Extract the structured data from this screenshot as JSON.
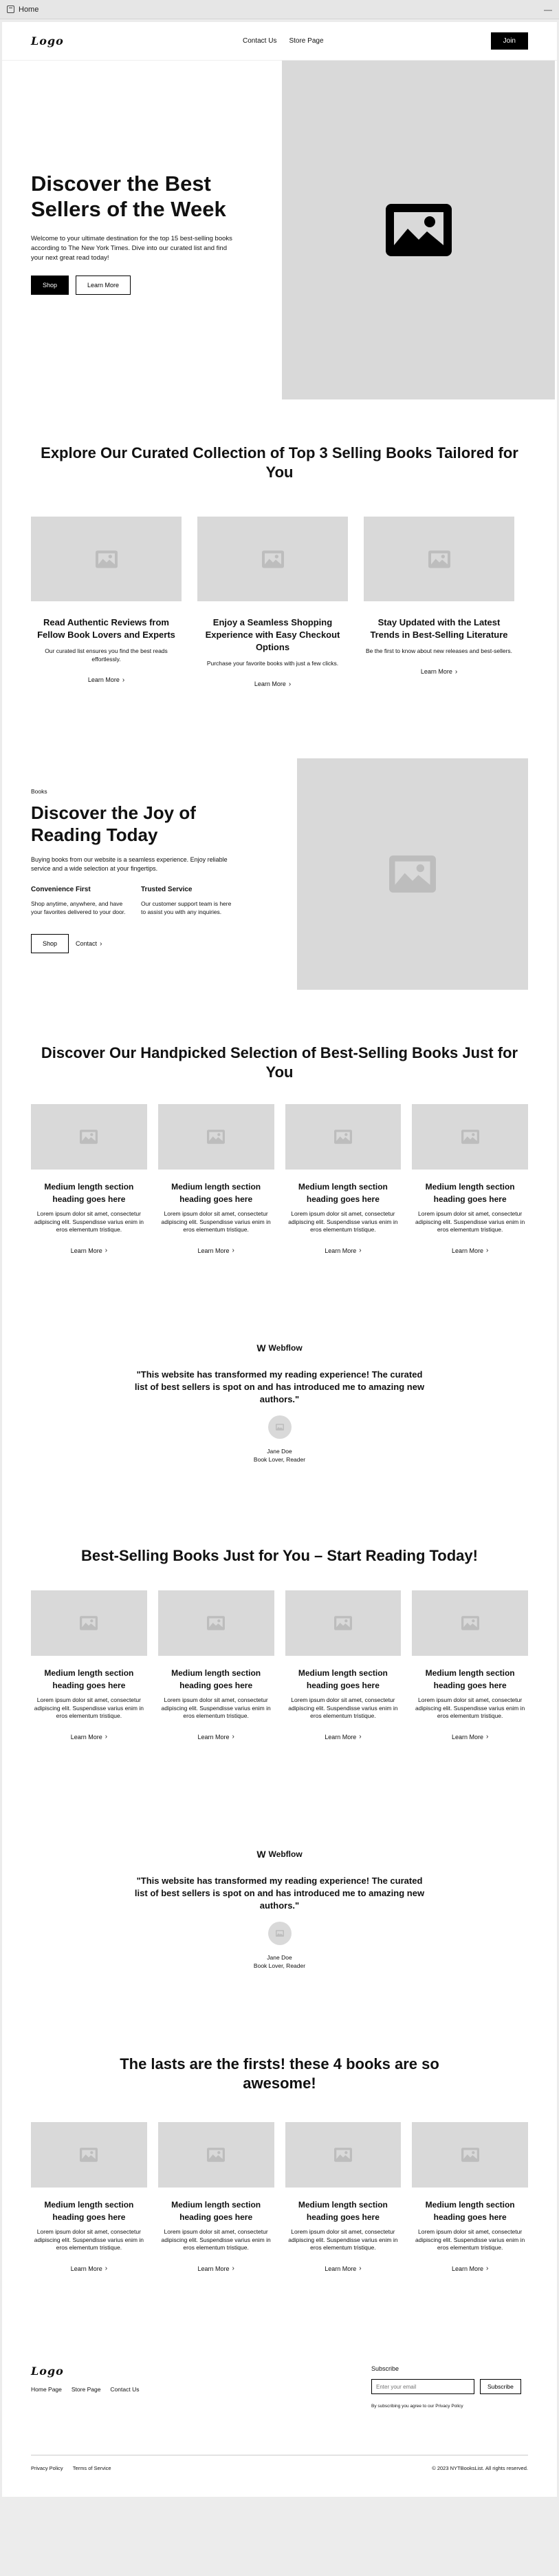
{
  "window": {
    "tab_title": "Home"
  },
  "nav": {
    "logo": "Logo",
    "links": [
      "Contact Us",
      "Store Page"
    ],
    "cta": "Join"
  },
  "hero": {
    "title": "Discover the Best Sellers of the Week",
    "description": "Welcome to your ultimate destination for the top 15 best-selling books according to The New York Times. Dive into our curated list and find your next great read today!",
    "primary": "Shop",
    "secondary": "Learn More"
  },
  "features": {
    "title": "Explore Our Curated Collection of Top 3 Selling Books Tailored for You",
    "items": [
      {
        "title": "Read Authentic Reviews from Fellow Book Lovers and Experts",
        "text": "Our curated list ensures you find the best reads effortlessly.",
        "link": "Learn More"
      },
      {
        "title": "Enjoy a Seamless Shopping Experience with Easy Checkout Options",
        "text": "Purchase your favorite books with just a few clicks.",
        "link": "Learn More"
      },
      {
        "title": "Stay Updated with the Latest Trends in Best-Selling Literature",
        "text": "Be the first to know about new releases and best-sellers.",
        "link": "Learn More"
      }
    ]
  },
  "split": {
    "tagline": "Books",
    "title": "Discover the Joy of Reading Today",
    "description": "Buying books from our website is a seamless experience. Enjoy reliable service and a wide selection at your fingertips.",
    "cols": [
      {
        "title": "Convenience First",
        "text": "Shop anytime, anywhere, and have your favorites delivered to your door."
      },
      {
        "title": "Trusted Service",
        "text": "Our customer support team is here to assist you with any inquiries."
      }
    ],
    "primary": "Shop",
    "secondary": "Contact"
  },
  "books1": {
    "title": "Discover Our Handpicked Selection of Best-Selling Books Just for You",
    "items": [
      {
        "title": "Medium length section heading goes here",
        "text": "Lorem ipsum dolor sit amet, consectetur adipiscing elit. Suspendisse varius enim in eros elementum tristique.",
        "link": "Learn More"
      },
      {
        "title": "Medium length section heading goes here",
        "text": "Lorem ipsum dolor sit amet, consectetur adipiscing elit. Suspendisse varius enim in eros elementum tristique.",
        "link": "Learn More"
      },
      {
        "title": "Medium length section heading goes here",
        "text": "Lorem ipsum dolor sit amet, consectetur adipiscing elit. Suspendisse varius enim in eros elementum tristique.",
        "link": "Learn More"
      },
      {
        "title": "Medium length section heading goes here",
        "text": "Lorem ipsum dolor sit amet, consectetur adipiscing elit. Suspendisse varius enim in eros elementum tristique.",
        "link": "Learn More"
      }
    ]
  },
  "testimonial1": {
    "brand": "Webflow",
    "quote": "\"This website has transformed my reading experience! The curated list of best sellers is spot on and has introduced me to amazing new authors.\"",
    "name": "Jane Doe",
    "role": "Book Lover, Reader"
  },
  "books2": {
    "title": "Best-Selling Books Just for You – Start Reading Today!",
    "items": [
      {
        "title": "Medium length section heading goes here",
        "text": "Lorem ipsum dolor sit amet, consectetur adipiscing elit. Suspendisse varius enim in eros elementum tristique.",
        "link": "Learn More"
      },
      {
        "title": "Medium length section heading goes here",
        "text": "Lorem ipsum dolor sit amet, consectetur adipiscing elit. Suspendisse varius enim in eros elementum tristique.",
        "link": "Learn More"
      },
      {
        "title": "Medium length section heading goes here",
        "text": "Lorem ipsum dolor sit amet, consectetur adipiscing elit. Suspendisse varius enim in eros elementum tristique.",
        "link": "Learn More"
      },
      {
        "title": "Medium length section heading goes here",
        "text": "Lorem ipsum dolor sit amet, consectetur adipiscing elit. Suspendisse varius enim in eros elementum tristique.",
        "link": "Learn More"
      }
    ]
  },
  "testimonial2": {
    "brand": "Webflow",
    "quote": "\"This website has transformed my reading experience! The curated list of best sellers is spot on and has introduced me to amazing new authors.\"",
    "name": "Jane Doe",
    "role": "Book Lover, Reader"
  },
  "books3": {
    "title": "The lasts are the firsts! these 4 books are so awesome!",
    "items": [
      {
        "title": "Medium length section heading goes here",
        "text": "Lorem ipsum dolor sit amet, consectetur adipiscing elit. Suspendisse varius enim in eros elementum tristique.",
        "link": "Learn More"
      },
      {
        "title": "Medium length section heading goes here",
        "text": "Lorem ipsum dolor sit amet, consectetur adipiscing elit. Suspendisse varius enim in eros elementum tristique.",
        "link": "Learn More"
      },
      {
        "title": "Medium length section heading goes here",
        "text": "Lorem ipsum dolor sit amet, consectetur adipiscing elit. Suspendisse varius enim in eros elementum tristique.",
        "link": "Learn More"
      },
      {
        "title": "Medium length section heading goes here",
        "text": "Lorem ipsum dolor sit amet, consectetur adipiscing elit. Suspendisse varius enim in eros elementum tristique.",
        "link": "Learn More"
      }
    ]
  },
  "footer": {
    "logo": "Logo",
    "links": [
      "Home Page",
      "Store Page",
      "Contact Us"
    ],
    "subscribe_title": "Subscribe",
    "email_placeholder": "Enter your email",
    "subscribe_button": "Subscribe",
    "consent": "By subscribing you agree to our Privacy Policy",
    "legal": [
      "Privacy Policy",
      "Terms of Service"
    ],
    "copyright": "© 2023 NYTBooksList. All rights reserved."
  }
}
